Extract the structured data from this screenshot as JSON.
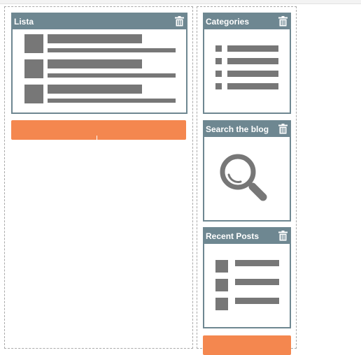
{
  "widgets": {
    "lista": {
      "title": "Lista",
      "icon": "trash-icon"
    },
    "categories": {
      "title": "Categories",
      "icon": "trash-icon"
    },
    "search": {
      "title": "Search the blog",
      "icon": "trash-icon"
    },
    "recent_posts": {
      "title": "Recent Posts",
      "icon": "trash-icon"
    }
  },
  "colors": {
    "header": "#6e8791",
    "accent": "#f4874f",
    "placeholder": "#777777"
  }
}
